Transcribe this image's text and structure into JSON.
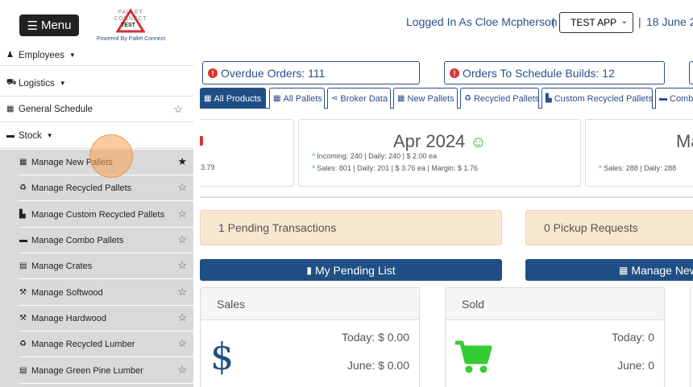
{
  "header": {
    "menu_label": "Menu",
    "logo_brand": "PALLET CONNECT",
    "logo_badge": "TEST",
    "logo_tagline": "Powered By Pallet Connect",
    "logged_in_text": "Logged In As Cloe Mcpherson",
    "separator": "|",
    "app_selected": "TEST APP",
    "date_text": "18 June 2"
  },
  "sidebar": {
    "items": [
      {
        "label": "Employees",
        "icon": "user-icon"
      },
      {
        "label": "Logistics",
        "icon": "truck-icon"
      },
      {
        "label": "General Schedule",
        "icon": "calendar-icon"
      },
      {
        "label": "Stock",
        "icon": "pallet-icon"
      }
    ],
    "sub_items": [
      {
        "label": "Manage New Pallets",
        "icon": "pallet-stack-icon",
        "starred": true
      },
      {
        "label": "Manage Recycled Pallets",
        "icon": "recycle-icon",
        "starred": false
      },
      {
        "label": "Manage Custom Recycled Pallets",
        "icon": "custom-pallet-icon",
        "starred": false
      },
      {
        "label": "Manage Combo Pallets",
        "icon": "combo-pallet-icon",
        "starred": false
      },
      {
        "label": "Manage Crates",
        "icon": "crate-icon",
        "starred": false
      },
      {
        "label": "Manage Softwood",
        "icon": "hammer-icon",
        "starred": false
      },
      {
        "label": "Manage Hardwood",
        "icon": "hammer-icon",
        "starred": false
      },
      {
        "label": "Manage Recycled Lumber",
        "icon": "recycle-icon",
        "starred": false
      },
      {
        "label": "Manage Green Pine Lumber",
        "icon": "crate-icon",
        "starred": false
      }
    ]
  },
  "alerts": {
    "overdue": "Overdue Orders: 111",
    "schedule": "Orders To Schedule Builds: 12"
  },
  "tabs": [
    {
      "label": "All Products",
      "icon": "pallet-stack-icon"
    },
    {
      "label": "All Pallets",
      "icon": "pallet-stack-icon"
    },
    {
      "label": "Broker Data",
      "icon": "share-icon"
    },
    {
      "label": "New Pallets",
      "icon": "pallet-stack-icon"
    },
    {
      "label": "Recycled Pallets",
      "icon": "recycle-icon"
    },
    {
      "label": "Custom Recycled Pallets",
      "icon": "custom-pallet-icon"
    },
    {
      "label": "Comb",
      "icon": "combo-pallet-icon"
    }
  ],
  "cards": {
    "left_partial_line": "3.79",
    "center": {
      "title": "Apr 2024",
      "incoming": "Incoming: 240 | Daily: 240 | $ 2.00 ea",
      "sales": "Sales: 801 | Daily: 201 | $ 3.76 ea | Margin: $ 1.76"
    },
    "right": {
      "title": "Ma",
      "sales": "Sales: 288 | Daily: 288"
    }
  },
  "pending": {
    "transactions": "1 Pending Transactions",
    "pickups": "0 Pickup Requests"
  },
  "buttons": {
    "my_pending_list": "My Pending List",
    "manage_new": "Manage New"
  },
  "panels": {
    "sales": {
      "title": "Sales",
      "today": "Today: $ 0.00",
      "month": "June: $ 0.00"
    },
    "sold": {
      "title": "Sold",
      "today": "Today: 0",
      "month": "June: 0"
    }
  }
}
